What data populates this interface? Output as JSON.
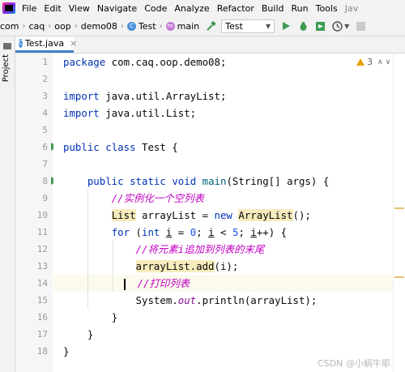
{
  "menubar": {
    "items": [
      "File",
      "Edit",
      "View",
      "Navigate",
      "Code",
      "Analyze",
      "Refactor",
      "Build",
      "Run",
      "Tools"
    ],
    "project_name": "Jav"
  },
  "navbar": {
    "crumbs": [
      "com",
      "caq",
      "oop",
      "demo08",
      "Test",
      "main"
    ],
    "run_config": "Test"
  },
  "sidebar": {
    "project_label": "Project"
  },
  "editor": {
    "tab_label": "Test.java",
    "warnings_count": "3",
    "lines": [
      {
        "n": "1"
      },
      {
        "n": "2"
      },
      {
        "n": "3"
      },
      {
        "n": "4"
      },
      {
        "n": "5"
      },
      {
        "n": "6"
      },
      {
        "n": "7"
      },
      {
        "n": "8"
      },
      {
        "n": "9"
      },
      {
        "n": "10"
      },
      {
        "n": "11"
      },
      {
        "n": "12"
      },
      {
        "n": "13"
      },
      {
        "n": "14"
      },
      {
        "n": "15"
      },
      {
        "n": "16"
      },
      {
        "n": "17"
      },
      {
        "n": "18"
      }
    ],
    "text": {
      "package_kw": "package",
      "package_name": " com.caq.oop.demo08;",
      "import_kw": "import",
      "import1": " java.util.ArrayList;",
      "import2": " java.util.List;",
      "public_kw": "public",
      "class_kw": "class",
      "class_name": " Test {",
      "static_kw": "static",
      "void_kw": "void",
      "main_name": "main",
      "main_params": "(String[] args) {",
      "comment1": "//实例化一个空列表",
      "list_type": "List",
      "decl_mid": " arrayList = ",
      "new_kw": "new",
      "arraylist_type": "ArrayList",
      "decl_end": "();",
      "for_kw": "for",
      "for_open": " (",
      "int_kw": "int",
      "var_i": "i",
      "eq": " = ",
      "zero": "0",
      "semi_sp": "; ",
      "lt": " < ",
      "five": "5",
      "incr": "++) {",
      "comment2": "//将元素i追加到列表的末尾",
      "add_call": "arrayList.add",
      "add_args": "(i);",
      "comment3": "//打印列表",
      "println_pre": "System.",
      "out_field": "out",
      "println_post": ".println(arrayList);",
      "close_brace": "}"
    }
  },
  "watermark": "CSDN @小蜗牛耶"
}
